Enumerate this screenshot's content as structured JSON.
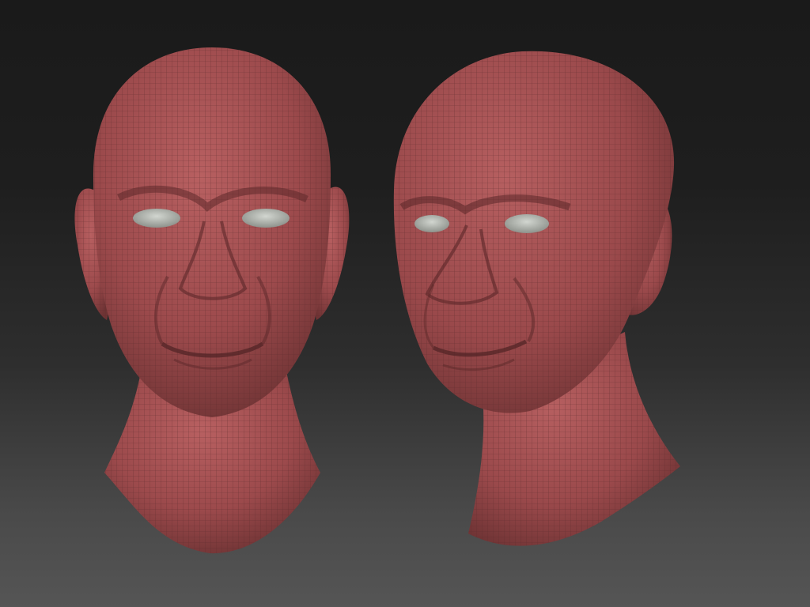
{
  "viewport": {
    "background_top": "#1a1a1a",
    "background_bottom": "#555555"
  },
  "models": [
    {
      "name": "head-front-view",
      "skin_color": "#a85455",
      "wire_color": "#5a2a2c",
      "eye_color": "#b8bcb6"
    },
    {
      "name": "head-three-quarter-view",
      "skin_color": "#a85455",
      "wire_color": "#5a2a2c",
      "eye_color": "#b8bcb6"
    }
  ]
}
